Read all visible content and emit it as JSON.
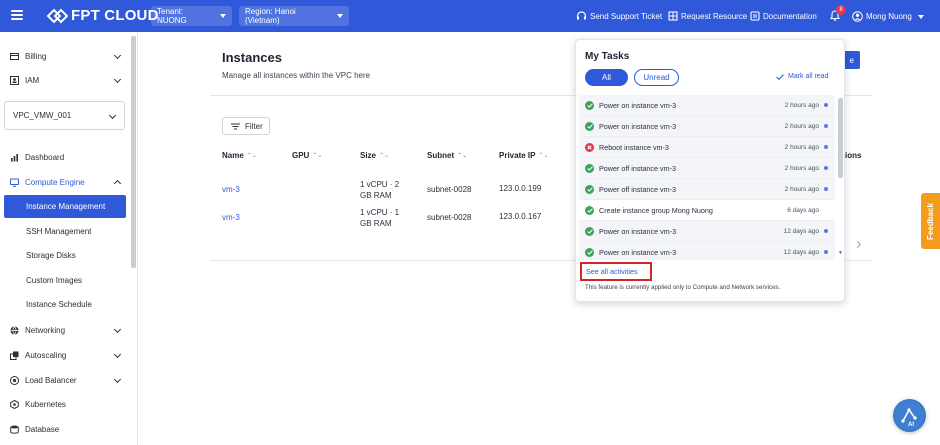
{
  "header": {
    "logo_text": "FPT CLOUD",
    "tenant_label": "Tenant: NUONG",
    "region_label": "Region: Hanoi (Vietnam)",
    "send_ticket": "Send Support Ticket",
    "request_resource": "Request Resource",
    "documentation": "Documentation",
    "notif_count": "8",
    "user_name": "Mong Nuong"
  },
  "sidebar": {
    "items": [
      {
        "label": "Billing",
        "icon": "billing-icon"
      },
      {
        "label": "IAM",
        "icon": "iam-icon"
      },
      {
        "label": "Dashboard",
        "icon": "chart-icon"
      },
      {
        "label": "Compute Engine",
        "icon": "monitor-icon"
      },
      {
        "label": "Networking",
        "icon": "network-icon"
      },
      {
        "label": "Autoscaling",
        "icon": "scale-icon"
      },
      {
        "label": "Load Balancer",
        "icon": "balancer-icon"
      },
      {
        "label": "Kubernetes",
        "icon": "kubernetes-icon"
      },
      {
        "label": "Database",
        "icon": "database-icon"
      }
    ],
    "vpc_selected": "VPC_VMW_001",
    "compute_sub": [
      {
        "label": "Instance Management",
        "active": true
      },
      {
        "label": "SSH Management"
      },
      {
        "label": "Storage Disks"
      },
      {
        "label": "Custom Images"
      },
      {
        "label": "Instance Schedule"
      }
    ]
  },
  "main": {
    "title": "Instances",
    "subtitle": "Manage all instances within the VPC here",
    "create_label": "e",
    "filter_label": "Filter",
    "columns": [
      "Name",
      "GPU",
      "Size",
      "Subnet",
      "Private IP",
      "ions"
    ],
    "rows": [
      {
        "name": "vm-3",
        "size_line1": "1 vCPU · 2",
        "size_line2": "GB RAM",
        "subnet": "subnet-0028",
        "ip": "123.0.0.199"
      },
      {
        "name": "vm-3",
        "size_line1": "1 vCPU · 1",
        "size_line2": "GB RAM",
        "subnet": "subnet-0028",
        "ip": "123.0.0.167"
      }
    ]
  },
  "tasks": {
    "title": "My Tasks",
    "tab_all": "All",
    "tab_unread": "Unread",
    "mark_all": "Mark all read",
    "items": [
      {
        "name": "Power on instance vm-3",
        "time": "2 hours ago",
        "status": "success",
        "unread": true
      },
      {
        "name": "Power on instance vm-3",
        "time": "2 hours ago",
        "status": "success",
        "unread": true
      },
      {
        "name": "Reboot instance vm-3",
        "time": "2 hours ago",
        "status": "error",
        "unread": true
      },
      {
        "name": "Power off instance vm-3",
        "time": "2 hours ago",
        "status": "success",
        "unread": true
      },
      {
        "name": "Power off instance vm-3",
        "time": "2 hours ago",
        "status": "success",
        "unread": true
      },
      {
        "name": "Create instance group Mong Nuong",
        "time": "6 days ago",
        "status": "success",
        "unread": false
      },
      {
        "name": "Power on instance vm-3",
        "time": "12 days ago",
        "status": "success",
        "unread": true
      },
      {
        "name": "Power on instance vm-3",
        "time": "12 days ago",
        "status": "success",
        "unread": true
      }
    ],
    "see_all": "See all activities",
    "note": "This feature is currently applied only to Compute and Network services."
  },
  "feedback_label": "Feedback",
  "colors": {
    "primary": "#2f59d9",
    "success": "#3aa35a",
    "error": "#e5364b",
    "feedback": "#f39c1f",
    "highlight_box": "#d8222a"
  }
}
